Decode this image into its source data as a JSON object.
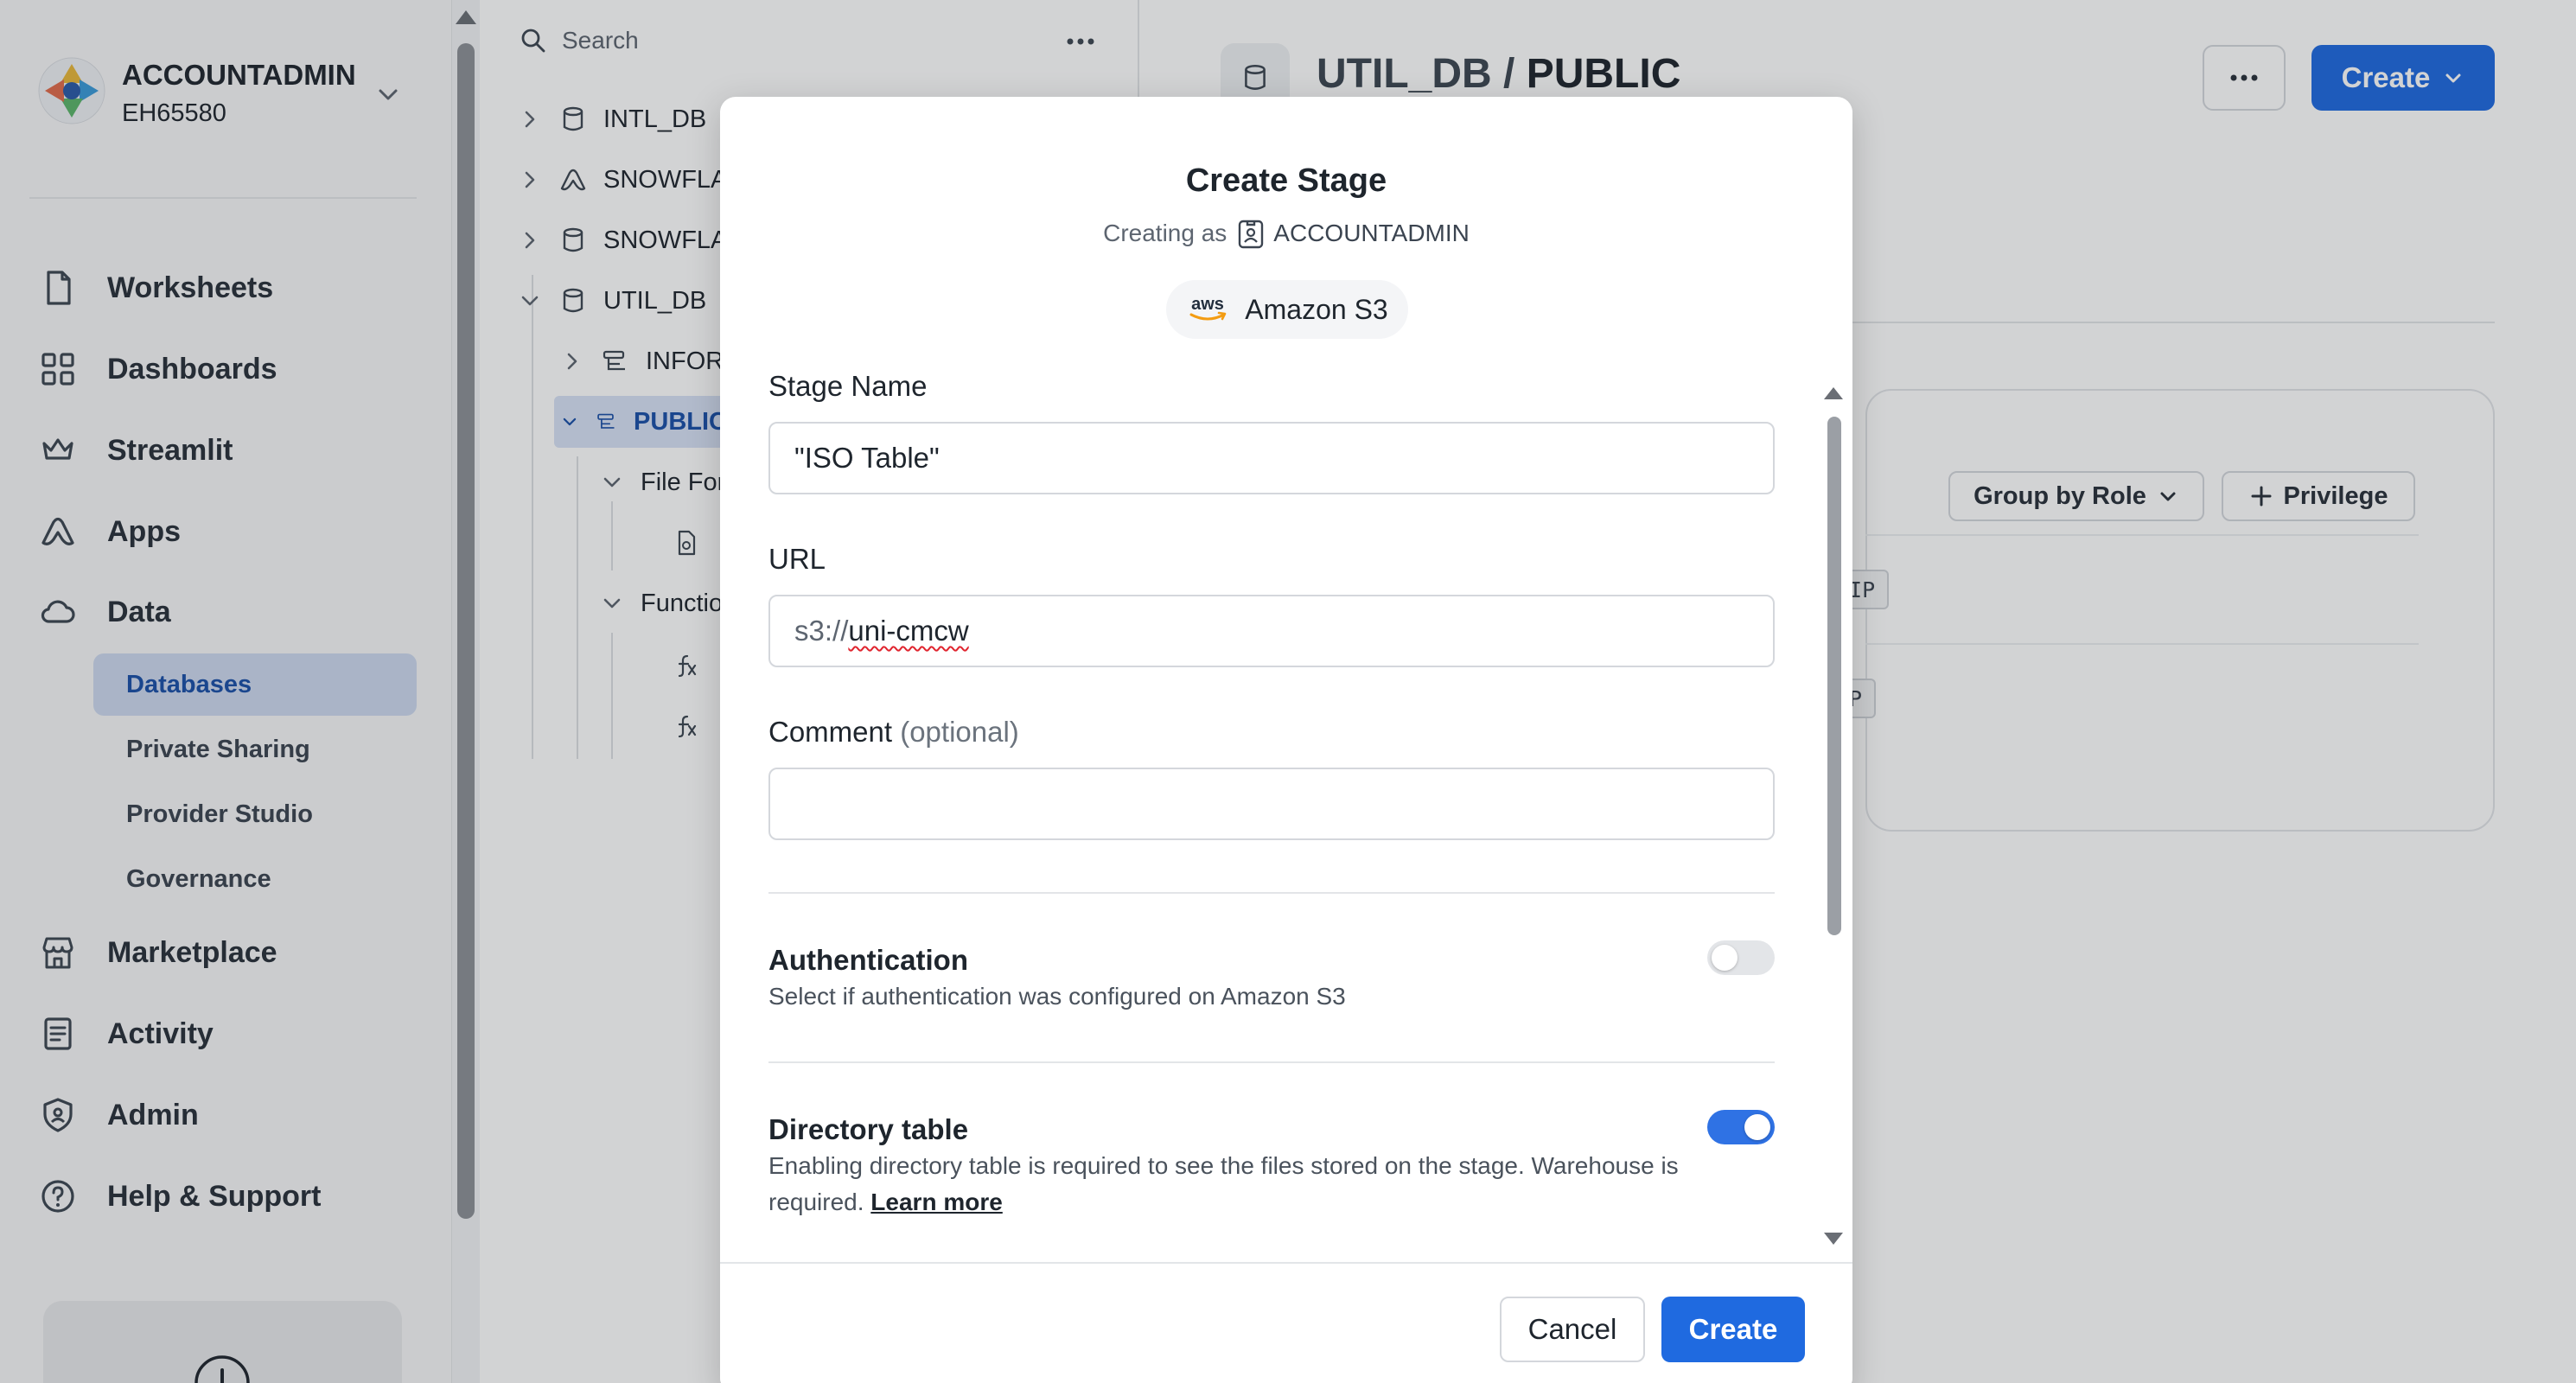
{
  "account": {
    "role": "ACCOUNTADMIN",
    "locator": "EH65580"
  },
  "nav": [
    {
      "label": "Worksheets",
      "icon": "file-icon"
    },
    {
      "label": "Dashboards",
      "icon": "grid-icon"
    },
    {
      "label": "Streamlit",
      "icon": "crown-icon"
    },
    {
      "label": "Apps",
      "icon": "apps-icon"
    },
    {
      "label": "Data",
      "icon": "cloud-icon"
    },
    {
      "label": "Marketplace",
      "icon": "store-icon"
    },
    {
      "label": "Activity",
      "icon": "activity-icon"
    },
    {
      "label": "Admin",
      "icon": "shield-icon"
    },
    {
      "label": "Help & Support",
      "icon": "help-icon"
    }
  ],
  "data_sub": [
    {
      "label": "Databases",
      "active": true
    },
    {
      "label": "Private Sharing"
    },
    {
      "label": "Provider Studio"
    },
    {
      "label": "Governance"
    }
  ],
  "explorer": {
    "search_placeholder": "Search",
    "tree": [
      {
        "label": "INTL_DB"
      },
      {
        "label": "SNOWFLAI"
      },
      {
        "label": "SNOWFLAI"
      },
      {
        "label": "UTIL_DB"
      },
      {
        "label": "INFORM"
      },
      {
        "label": "PUBLIC"
      },
      {
        "label": "File For"
      },
      {
        "label": ""
      },
      {
        "label": "Functio"
      },
      {
        "label": ""
      },
      {
        "label": ""
      }
    ]
  },
  "header": {
    "db": "UTIL_DB",
    "separator": "/",
    "schema": "PUBLIC",
    "create_label": "Create"
  },
  "privileges": {
    "group_label": "Group by Role",
    "add_label": "Privilege",
    "chip1": "HIP",
    "chip2": "IP"
  },
  "modal": {
    "title": "Create Stage",
    "creating_as_prefix": "Creating as",
    "creating_as_role": "ACCOUNTADMIN",
    "provider_logo": "aws",
    "provider": "Amazon S3",
    "stage_name_label": "Stage Name",
    "stage_name_value": "\"ISO Table\"",
    "url_label": "URL",
    "url_prefix": "s3://",
    "url_value": "uni-cmcw",
    "comment_label": "Comment",
    "comment_optional": "(optional)",
    "comment_value": "",
    "auth_title": "Authentication",
    "auth_desc": "Select if authentication was configured on Amazon S3",
    "auth_enabled": false,
    "dir_title": "Directory table",
    "dir_desc": "Enabling directory table is required to see the files stored on the stage. Warehouse is required.",
    "dir_link": "Learn more",
    "dir_enabled": true,
    "cancel_label": "Cancel",
    "create_label": "Create"
  },
  "colors": {
    "primary": "#1f6ae0",
    "active_nav_bg": "#cdd9ef",
    "active_nav_text": "#1a4fa8",
    "toggle_on": "#2f72e4"
  }
}
